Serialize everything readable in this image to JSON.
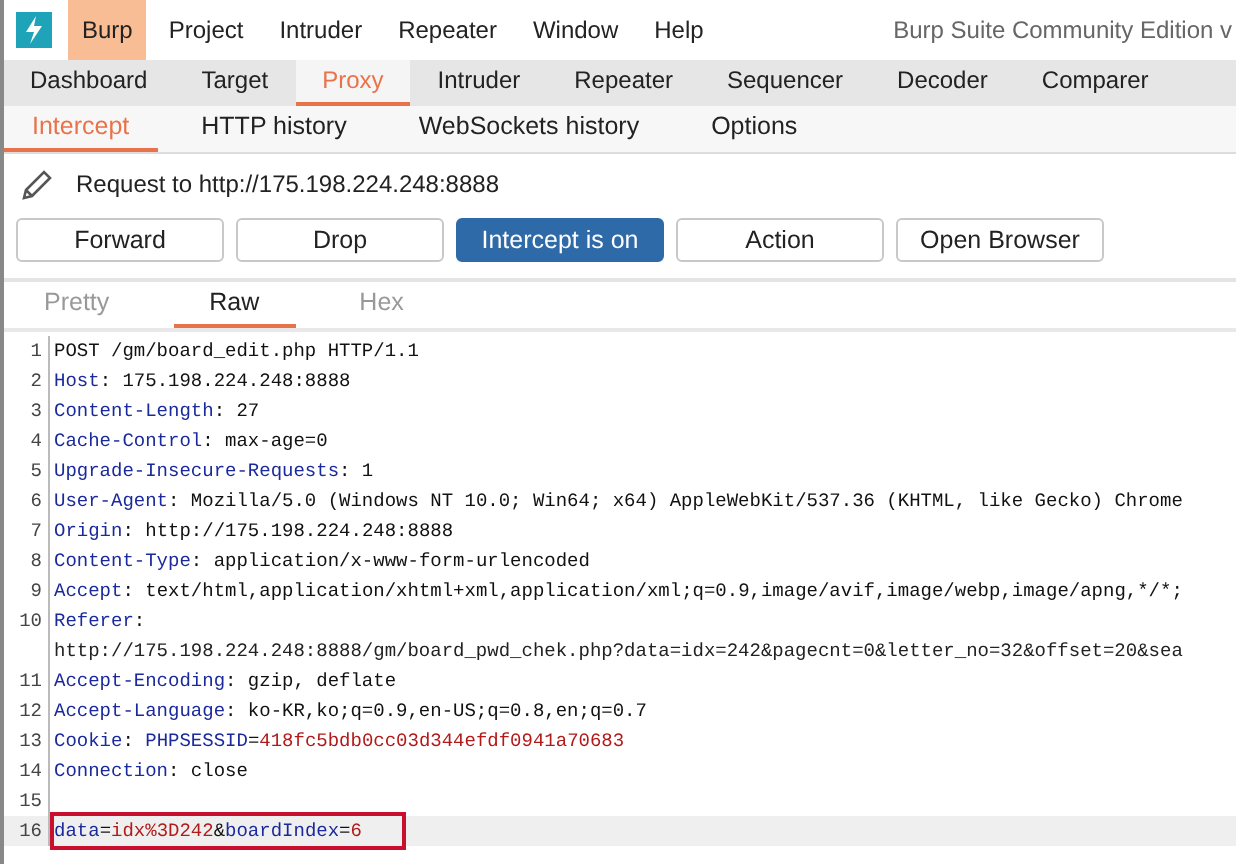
{
  "menu_bar": {
    "items": [
      {
        "label": "Burp",
        "selected": true
      },
      {
        "label": "Project",
        "selected": false
      },
      {
        "label": "Intruder",
        "selected": false
      },
      {
        "label": "Repeater",
        "selected": false
      },
      {
        "label": "Window",
        "selected": false
      },
      {
        "label": "Help",
        "selected": false
      }
    ],
    "title": "Burp Suite Community Edition v"
  },
  "main_tabs": [
    {
      "label": "Dashboard",
      "selected": false
    },
    {
      "label": "Target",
      "selected": false
    },
    {
      "label": "Proxy",
      "selected": true
    },
    {
      "label": "Intruder",
      "selected": false
    },
    {
      "label": "Repeater",
      "selected": false
    },
    {
      "label": "Sequencer",
      "selected": false
    },
    {
      "label": "Decoder",
      "selected": false
    },
    {
      "label": "Comparer",
      "selected": false
    }
  ],
  "sub_tabs": [
    {
      "label": "Intercept",
      "selected": true
    },
    {
      "label": "HTTP history",
      "selected": false
    },
    {
      "label": "WebSockets history",
      "selected": false
    },
    {
      "label": "Options",
      "selected": false
    }
  ],
  "request_info": "Request to http://175.198.224.248:8888",
  "buttons": [
    {
      "label": "Forward",
      "on": false
    },
    {
      "label": "Drop",
      "on": false
    },
    {
      "label": "Intercept is on",
      "on": true
    },
    {
      "label": "Action",
      "on": false
    },
    {
      "label": "Open Browser",
      "on": false
    }
  ],
  "editor_tabs": [
    {
      "label": "Pretty",
      "selected": false
    },
    {
      "label": "Raw",
      "selected": true
    },
    {
      "label": "Hex",
      "selected": false
    }
  ],
  "lines": [
    {
      "number": "1",
      "current": false,
      "marked": false,
      "parts": [
        {
          "kind": "plain",
          "text": "POST /gm/board_edit.php HTTP/1.1"
        }
      ]
    },
    {
      "number": "2",
      "current": false,
      "marked": false,
      "parts": [
        {
          "kind": "name",
          "text": "Host"
        },
        {
          "kind": "plain",
          "text": ": 175.198.224.248:8888"
        }
      ]
    },
    {
      "number": "3",
      "current": false,
      "marked": false,
      "parts": [
        {
          "kind": "name",
          "text": "Content-Length"
        },
        {
          "kind": "plain",
          "text": ": 27"
        }
      ]
    },
    {
      "number": "4",
      "current": false,
      "marked": false,
      "parts": [
        {
          "kind": "name",
          "text": "Cache-Control"
        },
        {
          "kind": "plain",
          "text": ": max-age=0"
        }
      ]
    },
    {
      "number": "5",
      "current": false,
      "marked": false,
      "parts": [
        {
          "kind": "name",
          "text": "Upgrade-Insecure-Requests"
        },
        {
          "kind": "plain",
          "text": ": 1"
        }
      ]
    },
    {
      "number": "6",
      "current": false,
      "marked": false,
      "parts": [
        {
          "kind": "name",
          "text": "User-Agent"
        },
        {
          "kind": "plain",
          "text": ": Mozilla/5.0 (Windows NT 10.0; Win64; x64) AppleWebKit/537.36 (KHTML, like Gecko) Chrome"
        }
      ]
    },
    {
      "number": "7",
      "current": false,
      "marked": false,
      "parts": [
        {
          "kind": "name",
          "text": "Origin"
        },
        {
          "kind": "plain",
          "text": ": http://175.198.224.248:8888"
        }
      ]
    },
    {
      "number": "8",
      "current": false,
      "marked": false,
      "parts": [
        {
          "kind": "name",
          "text": "Content-Type"
        },
        {
          "kind": "plain",
          "text": ": application/x-www-form-urlencoded"
        }
      ]
    },
    {
      "number": "9",
      "current": false,
      "marked": false,
      "parts": [
        {
          "kind": "name",
          "text": "Accept"
        },
        {
          "kind": "plain",
          "text": ": text/html,application/xhtml+xml,application/xml;q=0.9,image/avif,image/webp,image/apng,*/*;"
        }
      ]
    },
    {
      "number": "10",
      "current": false,
      "marked": false,
      "parts": [
        {
          "kind": "name",
          "text": "Referer"
        },
        {
          "kind": "plain",
          "text": ":"
        }
      ],
      "continuation": "http://175.198.224.248:8888/gm/board_pwd_chek.php?data=idx=242&pagecnt=0&letter_no=32&offset=20&sea"
    },
    {
      "number": "11",
      "current": false,
      "marked": false,
      "parts": [
        {
          "kind": "name",
          "text": "Accept-Encoding"
        },
        {
          "kind": "plain",
          "text": ": gzip, deflate"
        }
      ]
    },
    {
      "number": "12",
      "current": false,
      "marked": false,
      "parts": [
        {
          "kind": "name",
          "text": "Accept-Language"
        },
        {
          "kind": "plain",
          "text": ": ko-KR,ko;q=0.9,en-US;q=0.8,en;q=0.7"
        }
      ]
    },
    {
      "number": "13",
      "current": false,
      "marked": false,
      "parts": [
        {
          "kind": "name",
          "text": "Cookie"
        },
        {
          "kind": "plain",
          "text": ": "
        },
        {
          "kind": "name",
          "text": "PHPSESSID"
        },
        {
          "kind": "plain",
          "text": "="
        },
        {
          "kind": "value",
          "text": "418fc5bdb0cc03d344efdf0941a70683"
        }
      ]
    },
    {
      "number": "14",
      "current": false,
      "marked": false,
      "parts": [
        {
          "kind": "name",
          "text": "Connection"
        },
        {
          "kind": "plain",
          "text": ": close"
        }
      ]
    },
    {
      "number": "15",
      "current": false,
      "marked": false
    },
    {
      "number": "16",
      "current": true,
      "marked": true,
      "parts": [
        {
          "kind": "name",
          "text": "data"
        },
        {
          "kind": "plain",
          "text": "="
        },
        {
          "kind": "value",
          "text": "idx%3D242"
        },
        {
          "kind": "plain",
          "text": "&"
        },
        {
          "kind": "name",
          "text": "boardIndex"
        },
        {
          "kind": "plain",
          "text": "="
        },
        {
          "kind": "value",
          "text": "6"
        }
      ]
    }
  ]
}
